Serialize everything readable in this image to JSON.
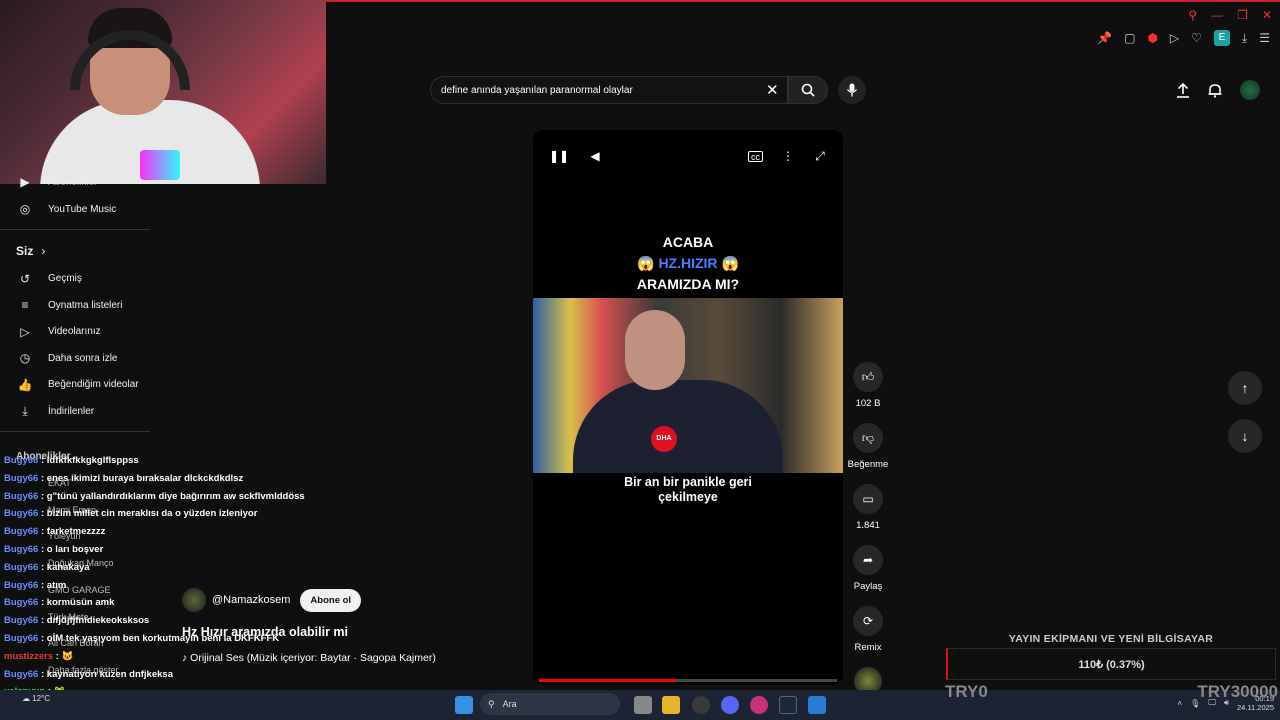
{
  "browser": {
    "extension_label": "E"
  },
  "search": {
    "value": "define anında yaşanılan paranormal olaylar"
  },
  "sidebar": {
    "top_items": [
      {
        "label": "Abonelikler",
        "icon": "subscriptions-icon"
      },
      {
        "label": "YouTube Music",
        "icon": "youtube-music-icon"
      }
    ],
    "you_header": "Siz",
    "you_chevron": "›",
    "you_items": [
      {
        "label": "Geçmiş",
        "icon": "history-icon"
      },
      {
        "label": "Oynatma listeleri",
        "icon": "playlists-icon"
      },
      {
        "label": "Videolarınız",
        "icon": "your-videos-icon"
      },
      {
        "label": "Daha sonra izle",
        "icon": "watch-later-icon"
      },
      {
        "label": "Beğendiğim videolar",
        "icon": "liked-videos-icon"
      },
      {
        "label": "İndirilenler",
        "icon": "downloads-icon"
      }
    ],
    "subs_header": "Abonelikler",
    "ghost_subs": [
      "EKAT",
      "Mami Emen",
      "Yöleyun",
      "Doğukan Manço",
      "GMO GARAGE",
      "Türk Mete",
      "Ali Can Boran",
      "Daha fazla göster"
    ]
  },
  "video": {
    "title_line1": "ACABA",
    "title_line2": "HZ.HIZIR",
    "title_line3": "ARAMIZDA MI?",
    "emoji": "😱",
    "mic_logo": "DHA",
    "caption_line1": "Bir an bir panikle geri",
    "caption_line2": "çekilmeye",
    "progress": 0.46
  },
  "channel": {
    "name": "@Namazkosem",
    "subscribe_label": "Abone ol",
    "video_title": "Hz Hızır aramızda olabilir mi",
    "audio": "♪ Orijinal Ses (Müzik içeriyor: Baytar · Sagopa Kajmer)"
  },
  "actions": {
    "like_count": "102 B",
    "dislike_label": "Beğenme",
    "comment_count": "1.841",
    "share_label": "Paylaş",
    "remix_label": "Remix"
  },
  "chat": [
    {
      "user": "Bugy66",
      "msg": "ldfkfkfkkgkglflsppss",
      "color": "u"
    },
    {
      "user": "Bugy66",
      "msg": "enes ikimizi buraya bıraksalar dlckckdkdlsz",
      "color": "u"
    },
    {
      "user": "Bugy66",
      "msg": "g\"tünü yallandırdıklarım diye bağırırım aw sckflvmlddöss",
      "color": "u"
    },
    {
      "user": "Bugy66",
      "msg": "bizim millet cin meraklısı da o yüzden izleniyor",
      "color": "u"
    },
    {
      "user": "Bugy66",
      "msg": "farketmezzzz",
      "color": "u"
    },
    {
      "user": "Bugy66",
      "msg": "o ları boşver",
      "color": "u"
    },
    {
      "user": "Bugy66",
      "msg": "kahakaya",
      "color": "u"
    },
    {
      "user": "Bugy66",
      "msg": "atım",
      "color": "u"
    },
    {
      "user": "Bugy66",
      "msg": "kormüsün amk",
      "color": "u"
    },
    {
      "user": "Bugy66",
      "msg": "dıfjdjfjfnidiekeoksksos",
      "color": "u"
    },
    {
      "user": "Bugy66",
      "msg": "oİM tek yaşıyom ben korkutmayın beni la DKFKFFK",
      "color": "u"
    },
    {
      "user": "mustizzers",
      "msg": "🐱",
      "color": "u2"
    },
    {
      "user": "Bugy66",
      "msg": "kaynatıyorı kuzen dnfjkeksa",
      "color": "u"
    },
    {
      "user": "velenyun",
      "msg": "🐸",
      "color": "u3"
    },
    {
      "user": "velenyun",
      "msg": "🐸",
      "color": "u3"
    }
  ],
  "goal": {
    "title": "YAYIN EKİPMANI VE YENİ BİLGİSAYAR",
    "progress_text": "110₺ (0.37%)",
    "min": "TRY0",
    "max": "TRY30000"
  },
  "taskbar": {
    "search_placeholder": "Ara",
    "weather": "12°C",
    "time": "00:19",
    "date": "24.11.2025"
  }
}
